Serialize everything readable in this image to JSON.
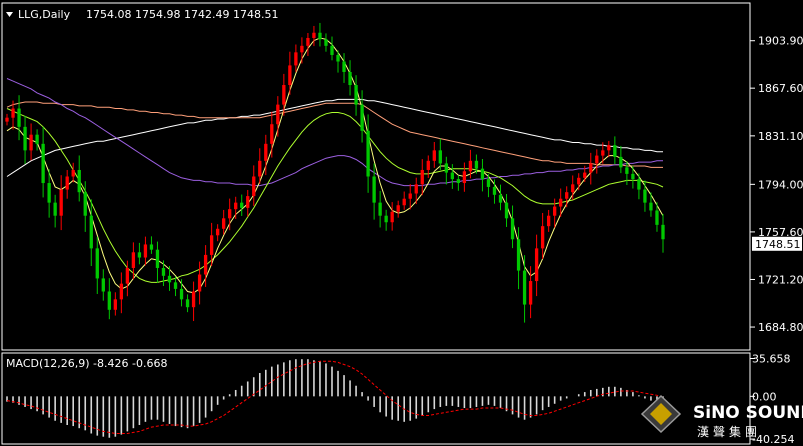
{
  "header": {
    "symbol_label": "LLG,Daily",
    "ohlc_text": "1754.08 1754.98 1742.49 1748.51"
  },
  "chart_data": {
    "type": "candlestick",
    "price_axis": {
      "ylim": [
        1668,
        1932
      ],
      "ticks": [
        "1903.90",
        "1867.60",
        "1831.10",
        "1794.00",
        "1757.60",
        "1721.20",
        "1684.80"
      ],
      "tick_values": [
        1903.9,
        1867.6,
        1831.1,
        1794.0,
        1757.6,
        1721.2,
        1684.8
      ],
      "current_price_label": "1748.51",
      "current_price": 1748.51
    },
    "closes": [
      1845,
      1852,
      1838,
      1820,
      1832,
      1825,
      1795,
      1780,
      1770,
      1790,
      1800,
      1805,
      1788,
      1770,
      1745,
      1722,
      1712,
      1698,
      1706,
      1718,
      1730,
      1742,
      1738,
      1748,
      1744,
      1730,
      1724,
      1719,
      1714,
      1706,
      1700,
      1712,
      1725,
      1740,
      1755,
      1760,
      1768,
      1775,
      1780,
      1776,
      1785,
      1800,
      1812,
      1825,
      1840,
      1855,
      1870,
      1885,
      1895,
      1900,
      1906,
      1910,
      1905,
      1900,
      1893,
      1888,
      1880,
      1870,
      1855,
      1835,
      1800,
      1780,
      1770,
      1765,
      1773,
      1778,
      1783,
      1787,
      1794,
      1805,
      1812,
      1820,
      1810,
      1803,
      1798,
      1795,
      1804,
      1812,
      1806,
      1798,
      1792,
      1786,
      1780,
      1768,
      1752,
      1728,
      1702,
      1720,
      1745,
      1762,
      1770,
      1777,
      1783,
      1788,
      1794,
      1799,
      1803,
      1810,
      1816,
      1820,
      1824,
      1815,
      1807,
      1802,
      1798,
      1790,
      1780,
      1774,
      1763,
      1752
    ],
    "indicators": {
      "ma_white": [
        1800,
        1803,
        1806,
        1809,
        1812,
        1814,
        1816,
        1818,
        1820,
        1821,
        1822,
        1823,
        1824,
        1825,
        1826,
        1827,
        1827,
        1828,
        1829,
        1830,
        1831,
        1832,
        1833,
        1834,
        1835,
        1836,
        1837,
        1838,
        1839,
        1840,
        1841,
        1841,
        1842,
        1843,
        1843,
        1844,
        1844,
        1845,
        1845,
        1846,
        1846,
        1847,
        1847,
        1848,
        1849,
        1850,
        1851,
        1852,
        1853,
        1854,
        1855,
        1856,
        1857,
        1858,
        1858,
        1859,
        1859,
        1859,
        1859,
        1859,
        1858,
        1858,
        1857,
        1856,
        1855,
        1854,
        1853,
        1852,
        1851,
        1850,
        1849,
        1848,
        1847,
        1846,
        1845,
        1844,
        1843,
        1842,
        1841,
        1840,
        1839,
        1838,
        1837,
        1836,
        1835,
        1834,
        1833,
        1832,
        1831,
        1830,
        1829,
        1828,
        1828,
        1827,
        1826,
        1826,
        1825,
        1825,
        1824,
        1824,
        1823,
        1823,
        1822,
        1822,
        1821,
        1821,
        1820,
        1820,
        1819,
        1819
      ],
      "ma_salmon": [
        1853,
        1855,
        1856,
        1857,
        1857,
        1857,
        1856,
        1856,
        1856,
        1855,
        1855,
        1855,
        1854,
        1854,
        1854,
        1853,
        1853,
        1853,
        1852,
        1852,
        1851,
        1851,
        1850,
        1850,
        1849,
        1849,
        1848,
        1848,
        1847,
        1847,
        1846,
        1846,
        1845,
        1845,
        1845,
        1845,
        1845,
        1845,
        1845,
        1845,
        1845,
        1845,
        1845,
        1846,
        1847,
        1848,
        1849,
        1850,
        1851,
        1852,
        1853,
        1854,
        1855,
        1856,
        1856,
        1856,
        1856,
        1856,
        1856,
        1855,
        1852,
        1849,
        1846,
        1843,
        1840,
        1838,
        1836,
        1834,
        1833,
        1832,
        1831,
        1830,
        1829,
        1828,
        1827,
        1826,
        1825,
        1824,
        1823,
        1822,
        1821,
        1820,
        1819,
        1818,
        1817,
        1816,
        1815,
        1814,
        1813,
        1812,
        1812,
        1811,
        1811,
        1810,
        1810,
        1810,
        1810,
        1810,
        1809,
        1809,
        1809,
        1809,
        1809,
        1808,
        1808,
        1808,
        1808,
        1807,
        1807,
        1807
      ],
      "ma_purple": [
        1875,
        1873,
        1871,
        1869,
        1867,
        1864,
        1862,
        1860,
        1857,
        1855,
        1852,
        1850,
        1847,
        1845,
        1842,
        1839,
        1836,
        1833,
        1830,
        1827,
        1824,
        1821,
        1818,
        1815,
        1812,
        1809,
        1806,
        1803,
        1801,
        1799,
        1798,
        1797,
        1797,
        1796,
        1796,
        1795,
        1795,
        1795,
        1794,
        1794,
        1794,
        1793,
        1793,
        1794,
        1795,
        1797,
        1799,
        1801,
        1803,
        1806,
        1808,
        1810,
        1812,
        1814,
        1815,
        1816,
        1816,
        1815,
        1813,
        1810,
        1806,
        1803,
        1800,
        1797,
        1795,
        1794,
        1793,
        1793,
        1793,
        1793,
        1794,
        1794,
        1795,
        1795,
        1796,
        1796,
        1797,
        1797,
        1798,
        1798,
        1799,
        1799,
        1800,
        1800,
        1801,
        1801,
        1802,
        1802,
        1803,
        1803,
        1804,
        1804,
        1804,
        1805,
        1805,
        1806,
        1806,
        1807,
        1807,
        1808,
        1808,
        1809,
        1809,
        1810,
        1810,
        1811,
        1811,
        1811,
        1812,
        1812
      ],
      "ma_green": [
        1852,
        1850,
        1848,
        1846,
        1844,
        1842,
        1838,
        1833,
        1827,
        1820,
        1813,
        1805,
        1797,
        1789,
        1780,
        1770,
        1760,
        1751,
        1743,
        1736,
        1730,
        1726,
        1722,
        1720,
        1719,
        1719,
        1720,
        1721,
        1722,
        1724,
        1725,
        1727,
        1729,
        1732,
        1736,
        1740,
        1745,
        1750,
        1756,
        1762,
        1769,
        1776,
        1784,
        1792,
        1800,
        1808,
        1815,
        1822,
        1828,
        1834,
        1839,
        1843,
        1846,
        1848,
        1849,
        1849,
        1848,
        1846,
        1842,
        1837,
        1831,
        1825,
        1819,
        1814,
        1810,
        1807,
        1805,
        1803,
        1802,
        1802,
        1802,
        1803,
        1804,
        1805,
        1806,
        1806,
        1806,
        1806,
        1805,
        1804,
        1803,
        1801,
        1799,
        1796,
        1793,
        1789,
        1785,
        1782,
        1780,
        1779,
        1779,
        1779,
        1780,
        1781,
        1782,
        1784,
        1786,
        1788,
        1790,
        1792,
        1794,
        1795,
        1796,
        1797,
        1797,
        1797,
        1796,
        1795,
        1794,
        1792
      ],
      "ma_yellow": [
        1835,
        1838,
        1836,
        1830,
        1828,
        1826,
        1815,
        1803,
        1792,
        1790,
        1793,
        1797,
        1794,
        1785,
        1770,
        1755,
        1740,
        1727,
        1718,
        1714,
        1716,
        1722,
        1728,
        1733,
        1737,
        1736,
        1733,
        1729,
        1724,
        1718,
        1712,
        1711,
        1714,
        1722,
        1733,
        1745,
        1755,
        1764,
        1771,
        1775,
        1779,
        1786,
        1796,
        1808,
        1821,
        1836,
        1851,
        1866,
        1879,
        1890,
        1898,
        1904,
        1906,
        1905,
        1901,
        1895,
        1888,
        1879,
        1868,
        1852,
        1832,
        1812,
        1795,
        1781,
        1774,
        1772,
        1773,
        1776,
        1781,
        1787,
        1795,
        1804,
        1808,
        1808,
        1805,
        1801,
        1800,
        1802,
        1804,
        1804,
        1800,
        1794,
        1787,
        1778,
        1766,
        1749,
        1731,
        1724,
        1727,
        1737,
        1750,
        1761,
        1771,
        1779,
        1786,
        1792,
        1798,
        1803,
        1808,
        1812,
        1816,
        1816,
        1814,
        1811,
        1806,
        1800,
        1793,
        1786,
        1778,
        1770
      ]
    },
    "macd": {
      "label": "MACD(12,26,9) -8.426 -0.668",
      "ylim": [
        -43,
        38
      ],
      "ticks": [
        "35.658",
        "0.00",
        "-40.254"
      ],
      "tick_values": [
        35.658,
        0,
        -40.254
      ],
      "histogram": [
        -5,
        -6,
        -8,
        -10,
        -12,
        -14,
        -17,
        -20,
        -23,
        -25,
        -27,
        -28,
        -30,
        -32,
        -35,
        -37,
        -38,
        -39,
        -38,
        -36,
        -33,
        -30,
        -27,
        -24,
        -22,
        -22,
        -24,
        -26,
        -28,
        -29,
        -30,
        -28,
        -25,
        -20,
        -14,
        -8,
        -3,
        2,
        6,
        10,
        14,
        18,
        22,
        25,
        28,
        30,
        32,
        34,
        35,
        35,
        35,
        34,
        33,
        31,
        28,
        24,
        20,
        15,
        10,
        4,
        -4,
        -10,
        -15,
        -19,
        -22,
        -23,
        -24,
        -23,
        -21,
        -18,
        -15,
        -12,
        -10,
        -9,
        -9,
        -10,
        -11,
        -11,
        -10,
        -9,
        -8,
        -9,
        -11,
        -14,
        -17,
        -20,
        -22,
        -20,
        -17,
        -13,
        -10,
        -7,
        -4,
        -2,
        0,
        2,
        4,
        6,
        7,
        8,
        9,
        9,
        8,
        6,
        4,
        1,
        -2,
        -4,
        -6,
        -8
      ],
      "signal": [
        -4,
        -5,
        -6,
        -8,
        -9,
        -11,
        -13,
        -15,
        -17,
        -19,
        -21,
        -23,
        -25,
        -27,
        -29,
        -31,
        -33,
        -34,
        -35,
        -35,
        -35,
        -34,
        -33,
        -31,
        -29,
        -28,
        -27,
        -27,
        -27,
        -27,
        -28,
        -28,
        -27,
        -26,
        -24,
        -21,
        -18,
        -14,
        -10,
        -6,
        -2,
        2,
        6,
        10,
        14,
        18,
        21,
        24,
        27,
        29,
        31,
        32,
        33,
        33,
        33,
        32,
        30,
        28,
        25,
        21,
        16,
        11,
        6,
        1,
        -4,
        -8,
        -12,
        -15,
        -17,
        -18,
        -18,
        -17,
        -16,
        -15,
        -14,
        -13,
        -12,
        -12,
        -12,
        -11,
        -11,
        -11,
        -11,
        -12,
        -13,
        -15,
        -17,
        -18,
        -18,
        -17,
        -16,
        -14,
        -12,
        -10,
        -8,
        -6,
        -4,
        -2,
        0,
        2,
        3,
        4,
        5,
        5,
        5,
        4,
        3,
        2,
        1,
        -1
      ]
    },
    "colors": {
      "bull": "#ff0000",
      "bear": "#00c800",
      "ma_white": "#ffffff",
      "ma_salmon": "#ffa07a",
      "ma_purple": "#9b5fe0",
      "ma_green": "#adff2f",
      "ma_yellow": "#ffff80",
      "macd_hist": "#d8d8d8",
      "macd_signal": "#ff0000",
      "axis": "#ffffff"
    }
  },
  "logo": {
    "line1": "SiNO SOUND",
    "line2": "漢聲集團"
  }
}
